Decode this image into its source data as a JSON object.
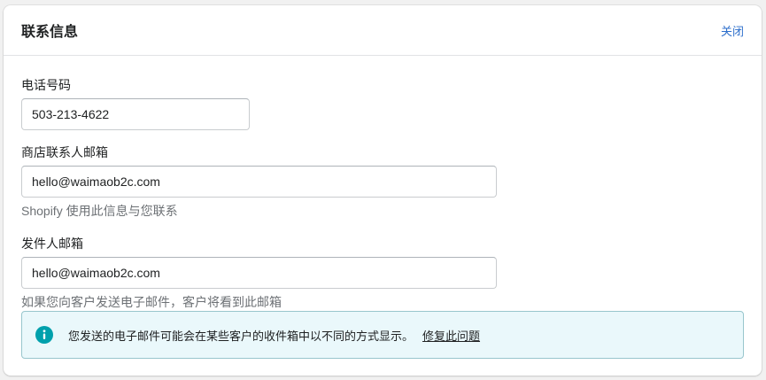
{
  "header": {
    "title": "联系信息",
    "close_label": "关闭"
  },
  "phone": {
    "label": "电话号码",
    "value": "503-213-4622"
  },
  "store_email": {
    "label": "商店联系人邮箱",
    "value": "hello@waimaob2c.com",
    "help": "Shopify 使用此信息与您联系"
  },
  "sender_email": {
    "label": "发件人邮箱",
    "value": "hello@waimaob2c.com",
    "help": "如果您向客户发送电子邮件，客户将看到此邮箱"
  },
  "banner": {
    "icon": "info-icon",
    "text": "您发送的电子邮件可能会在某些客户的收件箱中以不同的方式显示。",
    "link_label": "修复此问题"
  },
  "colors": {
    "accent": "#2c6ecb",
    "banner_bg": "#eaf8fb",
    "banner_border": "#98c6cd",
    "info_icon": "#00a0ac"
  }
}
